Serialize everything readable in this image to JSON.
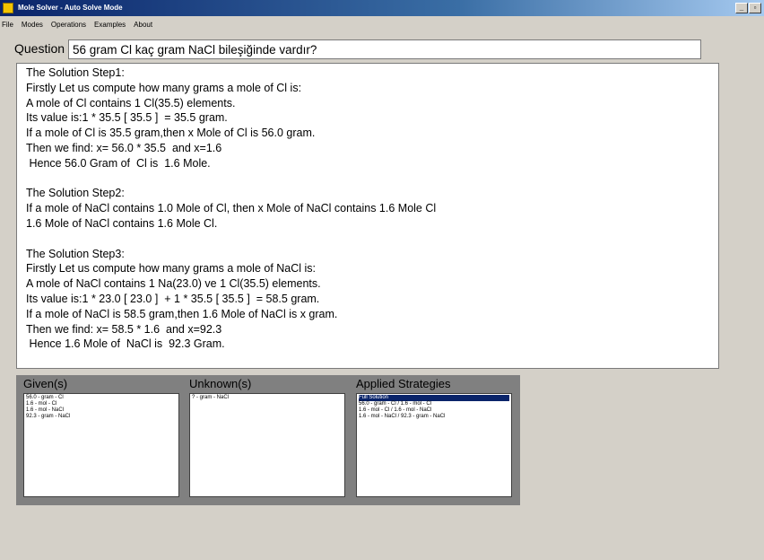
{
  "window": {
    "title": "Mole Solver - Auto Solve Mode",
    "minimize_glyph": "_",
    "maximize_glyph": "▫"
  },
  "menu": [
    "File",
    "Modes",
    "Operations",
    "Examples",
    "About"
  ],
  "question": {
    "label": "Question",
    "value": "56 gram Cl kaç gram NaCl bileşiğinde vardır?"
  },
  "solution_lines": [
    "The Solution Step1:",
    "Firstly Let us compute how many grams a mole of Cl is:",
    "A mole of Cl contains 1 Cl(35.5) elements.",
    "Its value is:1 * 35.5 [ 35.5 ]  = 35.5 gram.",
    "If a mole of Cl is 35.5 gram,then x Mole of Cl is 56.0 gram.",
    "Then we find: x= 56.0 * 35.5  and x=1.6",
    " Hence 56.0 Gram of  Cl is  1.6 Mole.",
    "",
    "The Solution Step2:",
    "If a mole of NaCl contains 1.0 Mole of Cl, then x Mole of NaCl contains 1.6 Mole Cl",
    "1.6 Mole of NaCl contains 1.6 Mole Cl.",
    "",
    "The Solution Step3:",
    "Firstly Let us compute how many grams a mole of NaCl is:",
    "A mole of NaCl contains 1 Na(23.0) ve 1 Cl(35.5) elements.",
    "Its value is:1 * 23.0 [ 23.0 ]  + 1 * 35.5 [ 35.5 ]  = 58.5 gram.",
    "If a mole of NaCl is 58.5 gram,then 1.6 Mole of NaCl is x gram.",
    "Then we find: x= 58.5 * 1.6  and x=92.3",
    " Hence 1.6 Mole of  NaCl is  92.3 Gram."
  ],
  "panels": {
    "given": {
      "title": "Given(s)",
      "items": [
        "56.0 - gram - Cl",
        "1.6 - mol - Cl",
        "1.6 - mol - NaCl",
        "92.3 - gram - NaCl"
      ]
    },
    "unknown": {
      "title": "Unknown(s)",
      "items": [
        "? - gram - NaCl"
      ]
    },
    "strategies": {
      "title": "Applied Strategies",
      "items": [
        "Full Solution",
        "56.0 - gram - Cl /  1.6 - mol - Cl",
        "1.6 - mol - Cl /  1.6 - mol - NaCl",
        "1.6 - mol - NaCl /  92.3 - gram - NaCl"
      ],
      "selected_index": 0
    }
  }
}
